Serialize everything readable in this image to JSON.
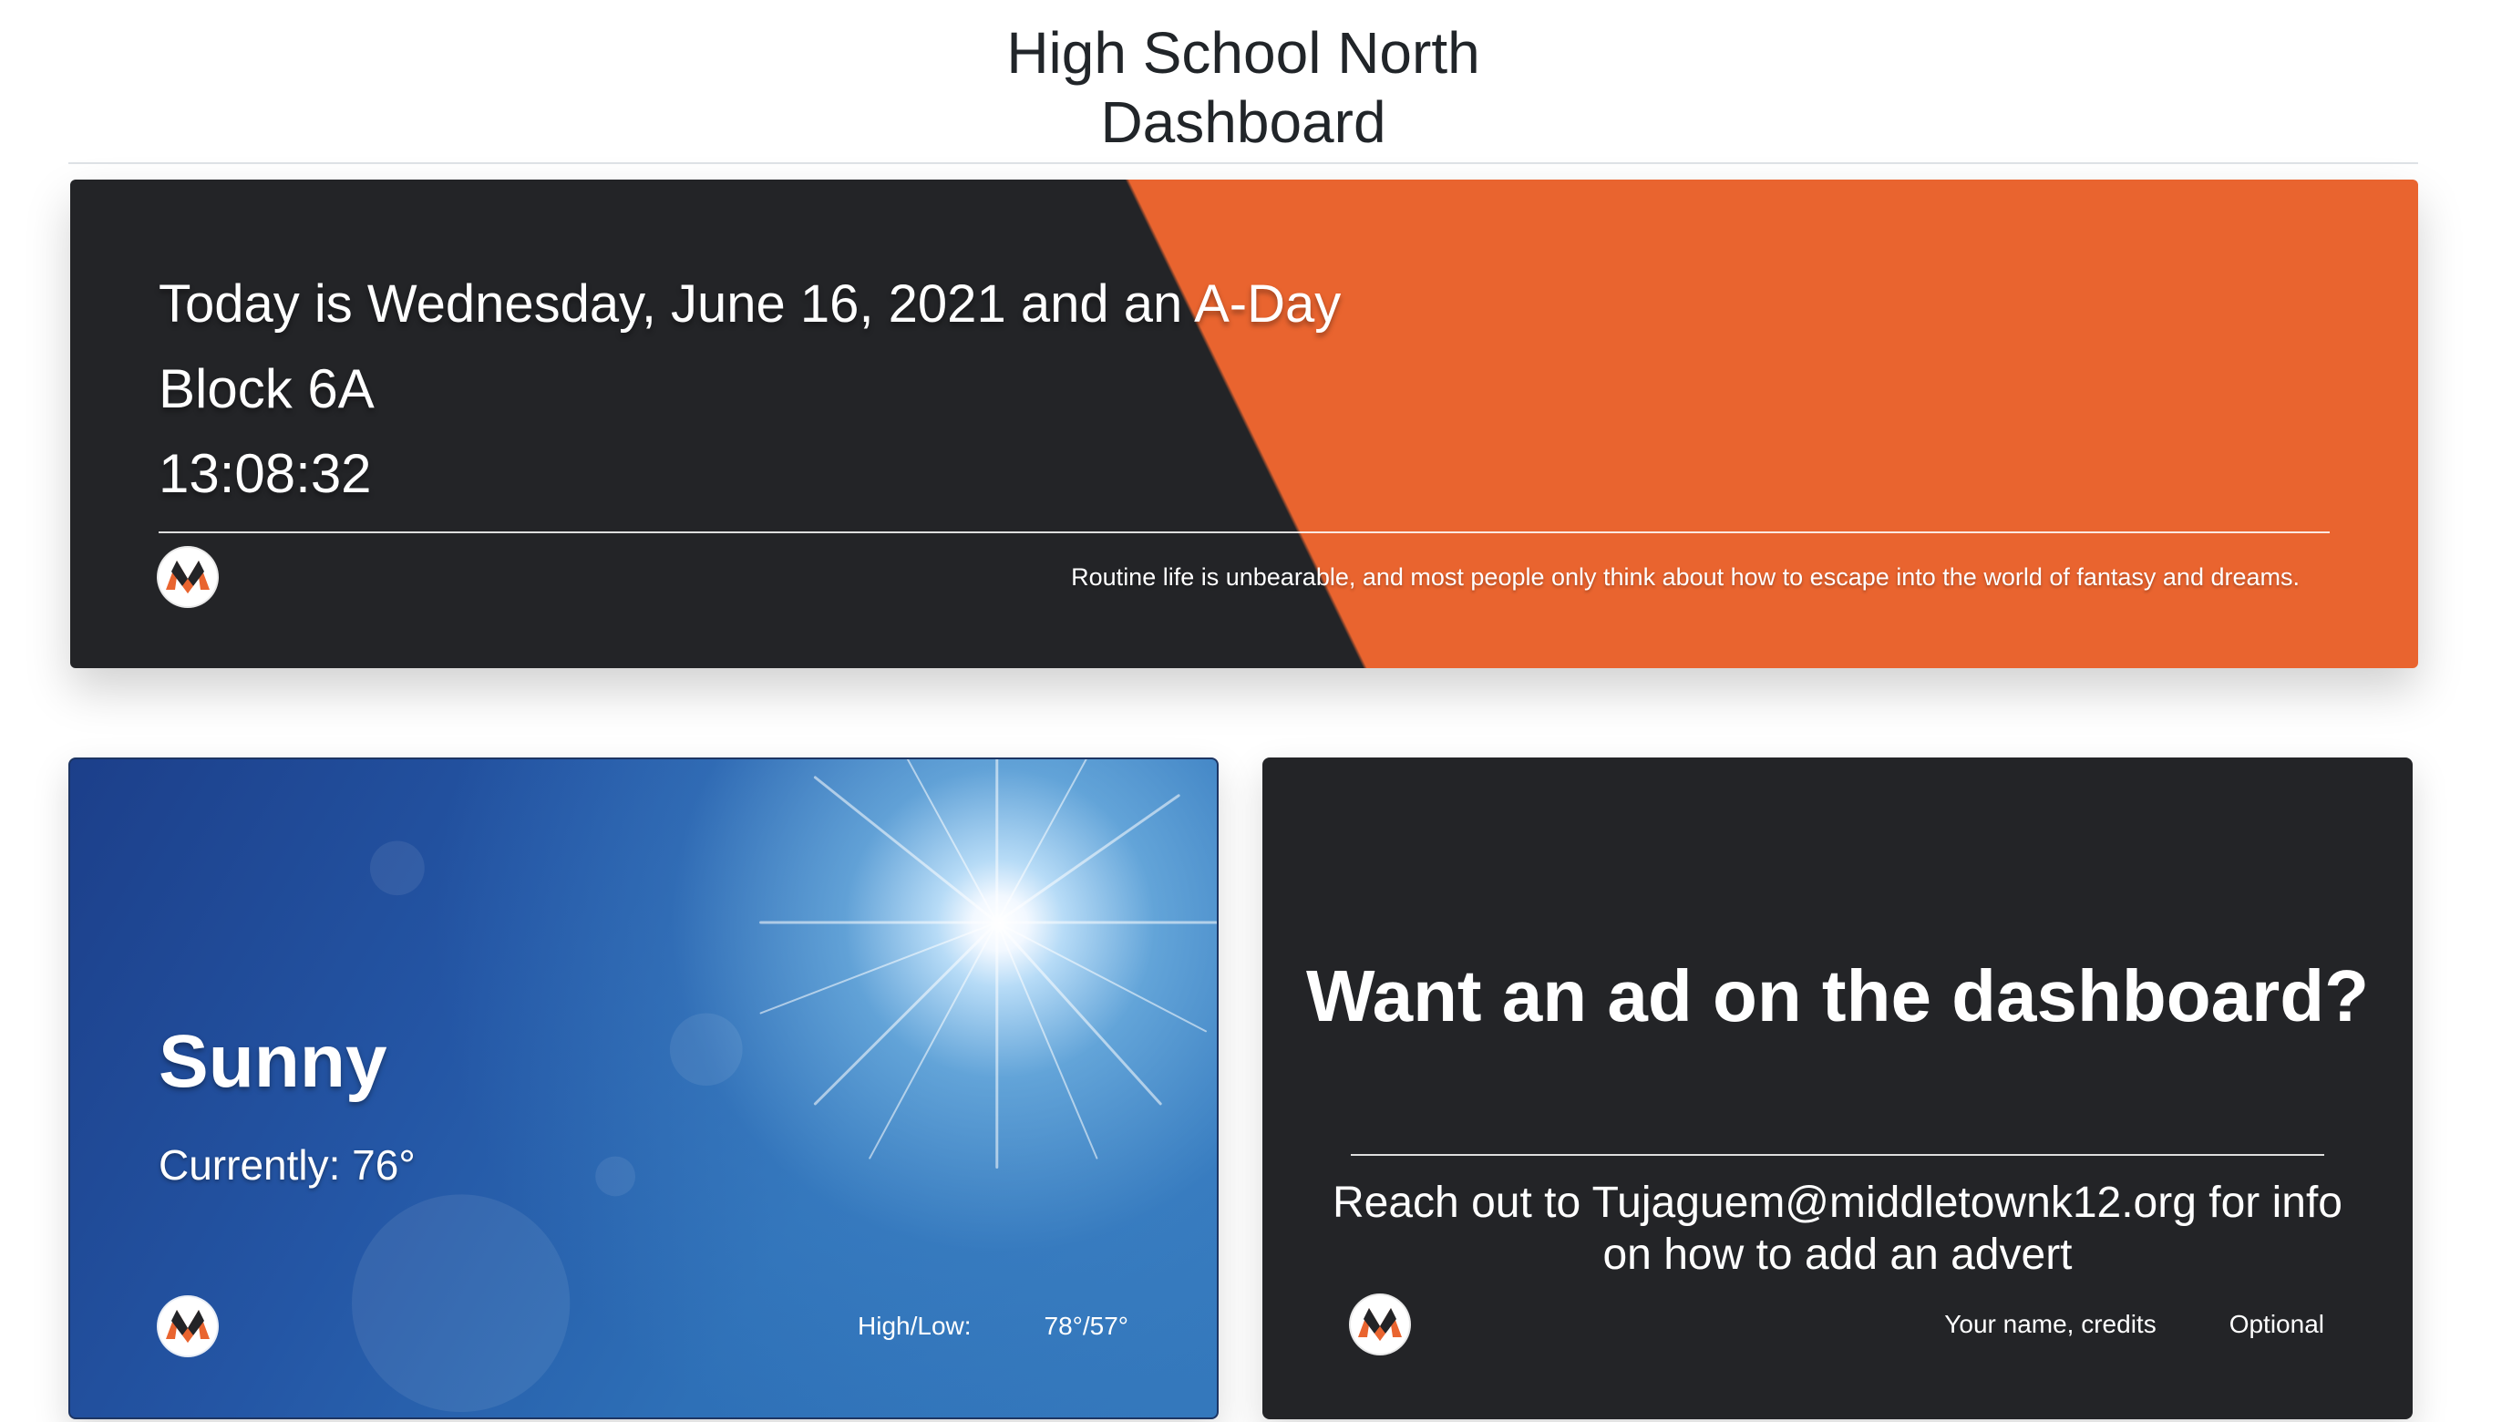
{
  "header": {
    "title_line1": "High School North",
    "title_line2": "Dashboard"
  },
  "banner": {
    "date_line": "Today is Wednesday, June 16, 2021 and an A-Day",
    "block": "Block 6A",
    "time": "13:08:32",
    "quote": "Routine life is unbearable, and most people only think about how to escape into the world of fantasy and dreams.",
    "colors": {
      "dark": "#232427",
      "accent": "#e9642f"
    },
    "logo_icon": "school-logo-icon"
  },
  "weather": {
    "condition": "Sunny",
    "current": "Currently: 76°",
    "high_low_label": "High/Low:",
    "high_low_value": "78°/57°",
    "logo_icon": "school-logo-icon"
  },
  "ad": {
    "title": "Want an ad on the dashboard?",
    "body": "Reach out to Tujaguem@middletownk12.org for info on how to add an advert",
    "credits": "Your name, credits",
    "optional": "Optional",
    "logo_icon": "school-logo-icon"
  }
}
